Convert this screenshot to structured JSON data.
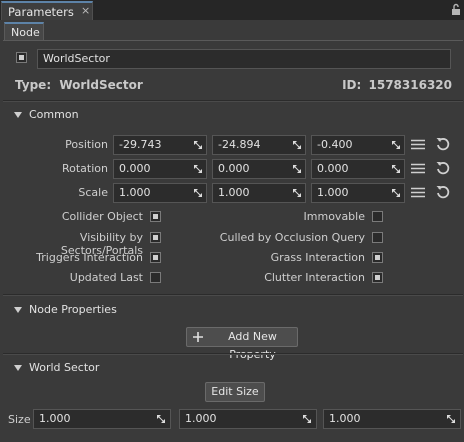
{
  "window": {
    "tab_title": "Parameters",
    "close_glyph": "×"
  },
  "subtab": {
    "label": "Node"
  },
  "node": {
    "name_value": "WorldSector",
    "type_label": "Type:",
    "type_value": "WorldSector",
    "id_label": "ID:",
    "id_value": "1578316320"
  },
  "common": {
    "title": "Common",
    "rows": [
      {
        "label": "Position",
        "values": [
          "-29.743",
          "-24.894",
          "-0.400"
        ]
      },
      {
        "label": "Rotation",
        "values": [
          "0.000",
          "0.000",
          "0.000"
        ]
      },
      {
        "label": "Scale",
        "values": [
          "1.000",
          "1.000",
          "1.000"
        ]
      }
    ],
    "flags_left": [
      {
        "label": "Collider Object",
        "checked": true
      },
      {
        "label": "Visibility by Sectors/Portals",
        "checked": true
      },
      {
        "label": "Triggers Interaction",
        "checked": true
      },
      {
        "label": "Updated Last",
        "checked": false
      }
    ],
    "flags_right": [
      {
        "label": "Immovable",
        "checked": false
      },
      {
        "label": "Culled by Occlusion Query",
        "checked": false
      },
      {
        "label": "Grass Interaction",
        "checked": true
      },
      {
        "label": "Clutter Interaction",
        "checked": true
      }
    ]
  },
  "node_properties": {
    "title": "Node Properties",
    "add_button": "Add New Property"
  },
  "world_sector": {
    "title": "World Sector",
    "edit_button": "Edit Size",
    "size_label": "Size",
    "size_values": [
      "1.000",
      "1.000",
      "1.000"
    ]
  }
}
